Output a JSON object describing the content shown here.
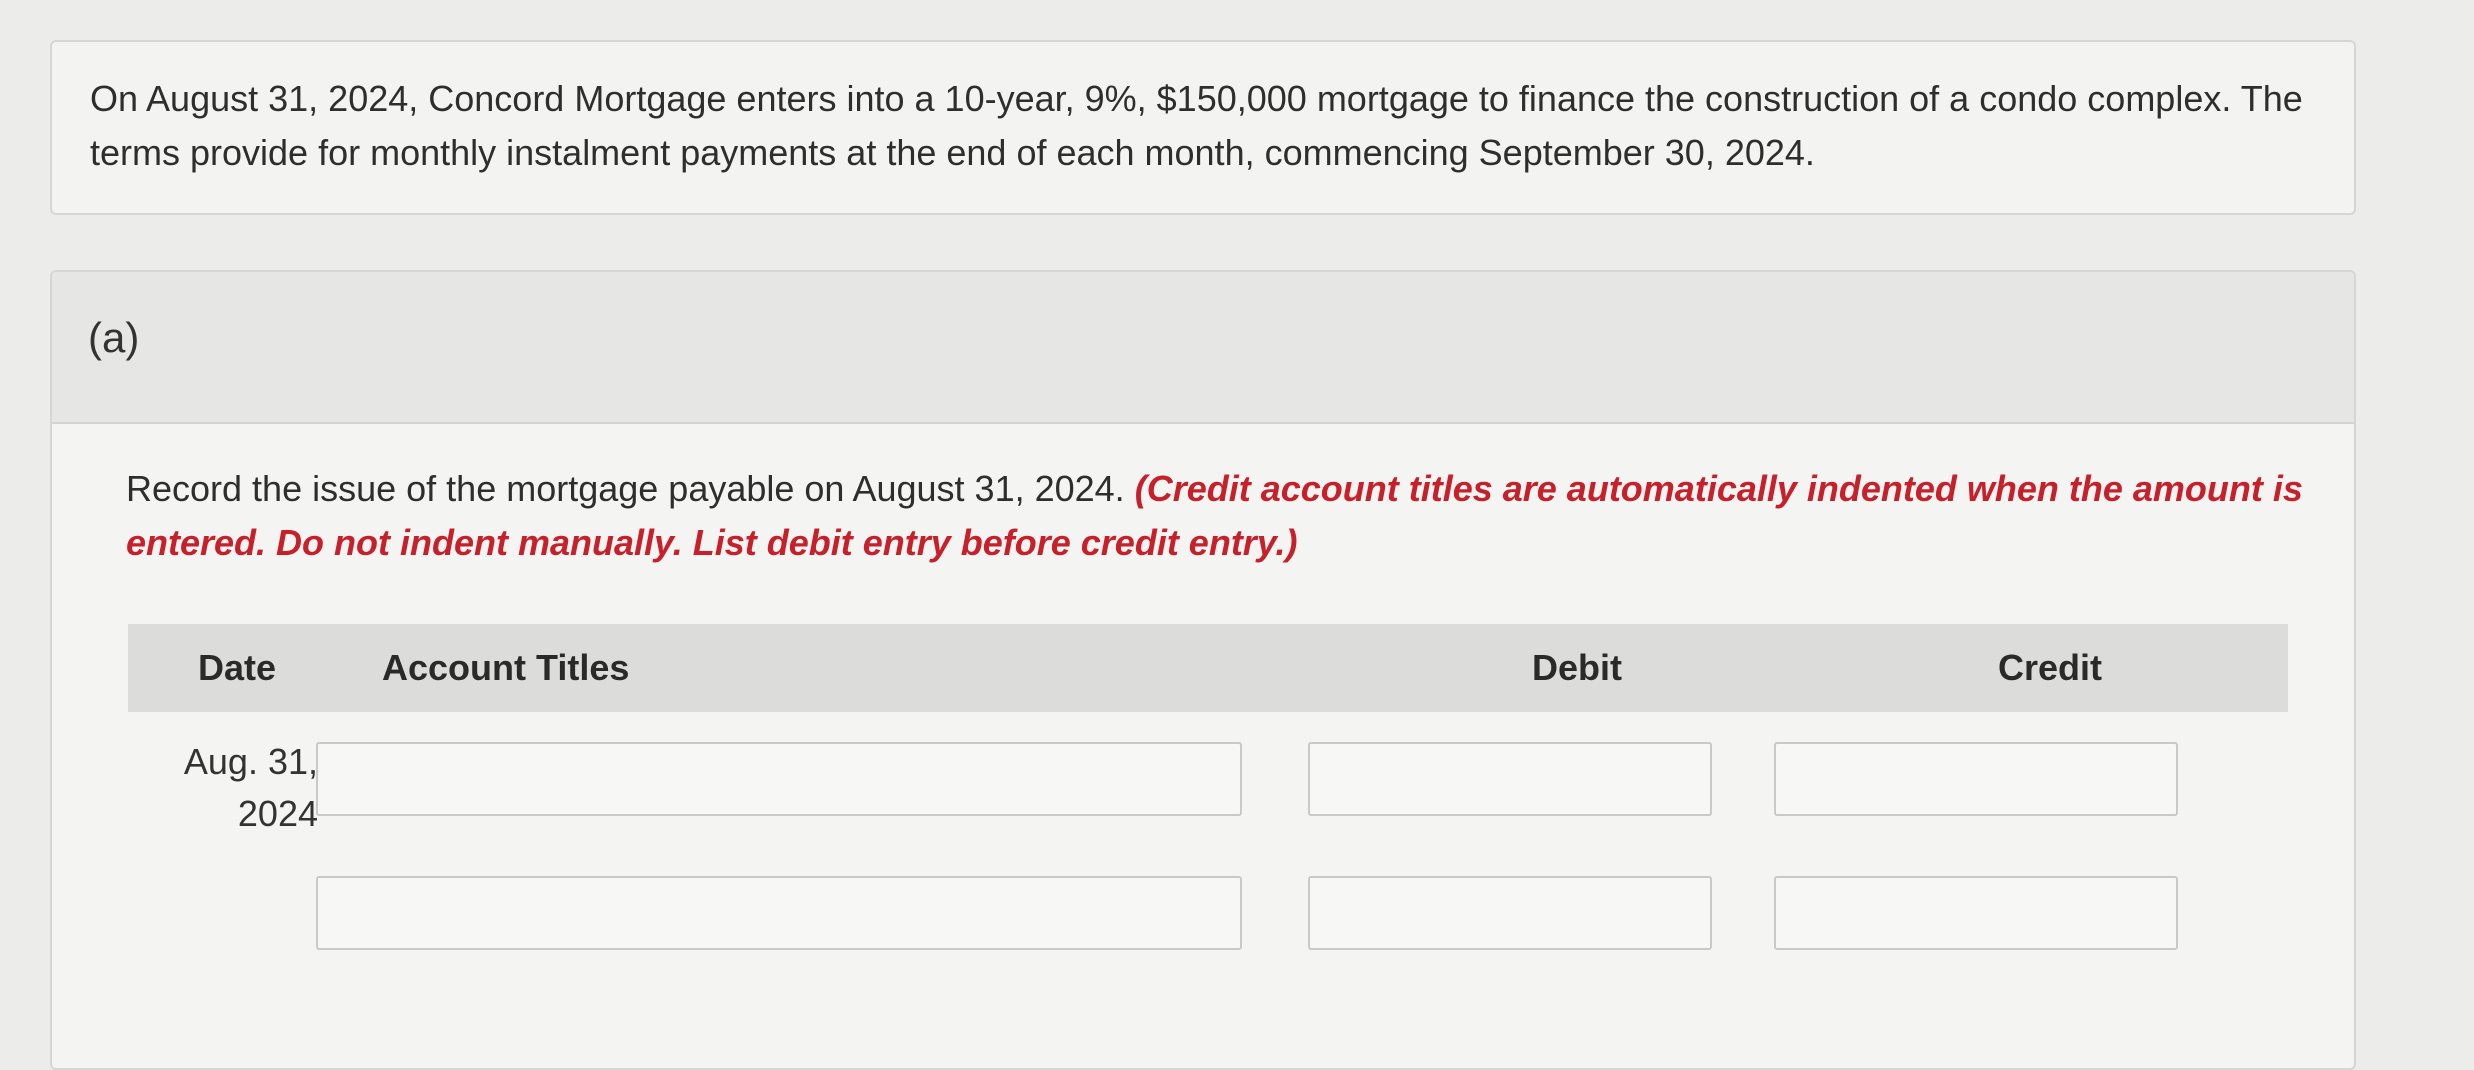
{
  "problem": {
    "text": "On August 31, 2024, Concord Mortgage enters into a 10-year, 9%, $150,000 mortgage to finance the construction of a condo complex. The terms provide for monthly instalment payments at the end of each month, commencing September 30, 2024."
  },
  "part": {
    "label": "(a)",
    "instruction": "Record the issue of the mortgage payable on August 31, 2024.",
    "note": "(Credit account titles are automatically indented when the amount is entered. Do not indent manually. List debit entry before credit entry.)"
  },
  "table": {
    "headers": {
      "date": "Date",
      "account_titles": "Account Titles",
      "debit": "Debit",
      "credit": "Credit"
    },
    "rows": [
      {
        "date_line1": "Aug. 31,",
        "date_line2": "2024",
        "account": "",
        "debit": "",
        "credit": ""
      },
      {
        "date_line1": "",
        "date_line2": "",
        "account": "",
        "debit": "",
        "credit": ""
      }
    ]
  },
  "colors": {
    "note_red": "#c8202a",
    "header_gray": "#dcdcda",
    "background": "#ececea"
  }
}
